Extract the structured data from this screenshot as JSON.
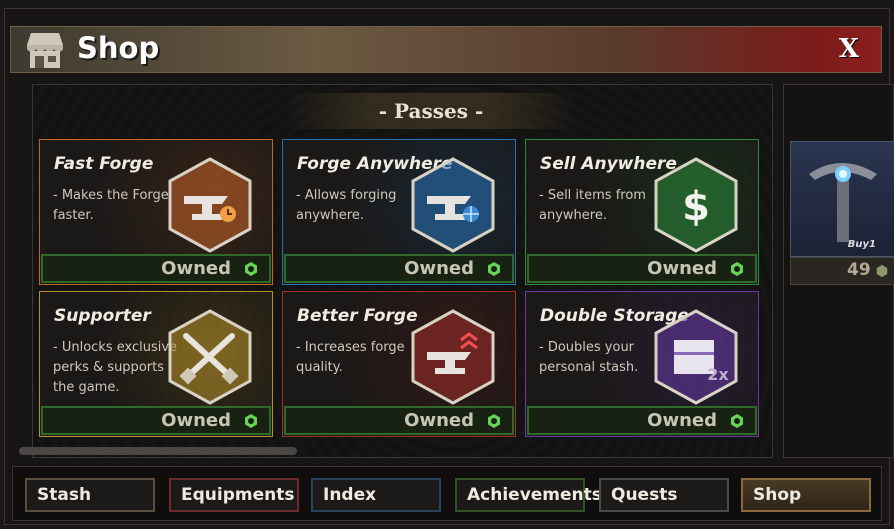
{
  "window": {
    "title": "Shop",
    "close_label": "X"
  },
  "section": {
    "title": "- Passes -"
  },
  "cards": [
    {
      "name": "Fast Forge",
      "desc": "- Makes the Forge faster.",
      "status": "Owned",
      "icon": "anvil-clock-icon",
      "color": "#c5642a"
    },
    {
      "name": "Forge Anywhere",
      "desc": "- Allows forging anywhere.",
      "status": "Owned",
      "icon": "anvil-globe-icon",
      "color": "#2a72b8"
    },
    {
      "name": "Sell Anywhere",
      "desc": "- Sell items from anywhere.",
      "status": "Owned",
      "icon": "dollar-icon",
      "color": "#2d8a3a"
    },
    {
      "name": "Supporter",
      "desc": "- Unlocks exclusive perks & supports the game.",
      "status": "Owned",
      "icon": "crossed-swords-icon",
      "color": "#b7902a"
    },
    {
      "name": "Better Forge",
      "desc": "- Increases forge quality.",
      "status": "Owned",
      "icon": "anvil-upgrade-icon",
      "color": "#a3302c"
    },
    {
      "name": "Double Storage",
      "desc": "- Doubles your personal stash.",
      "status": "Owned",
      "icon": "chest-2x-icon",
      "color": "#6a3aa8"
    }
  ],
  "side_item": {
    "label": "Buy1",
    "price": "49",
    "icon": "pickaxe-icon"
  },
  "tabs": [
    {
      "label": "Stash",
      "color": "#5a4e3c"
    },
    {
      "label": "Equipments",
      "color": "#6a2c2a"
    },
    {
      "label": "Index",
      "color": "#2c405a"
    },
    {
      "label": "Achievements",
      "color": "#33502a"
    },
    {
      "label": "Quests",
      "color": "#4a4a4a"
    },
    {
      "label": "Shop",
      "color": "#8a6a3a"
    }
  ]
}
